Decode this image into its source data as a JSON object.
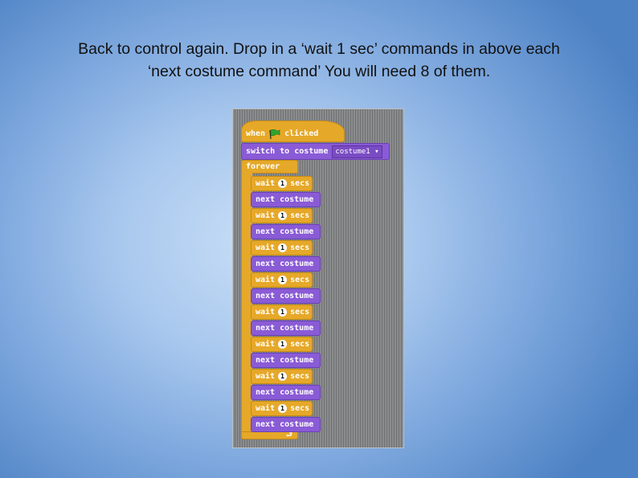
{
  "caption": {
    "line1": "Back to control again.  Drop in a ‘wait 1 sec’ commands in above each",
    "line2": "‘next costume command’  You will need 8 of them."
  },
  "script": {
    "hat": {
      "when": "when",
      "clicked": "clicked",
      "icon": "green-flag-icon"
    },
    "switch": {
      "label": "switch to costume",
      "value": "costume1"
    },
    "forever": "forever",
    "wait_label": "wait",
    "wait_value": "1",
    "secs_label": "secs",
    "next_label": "next costume",
    "pairs": 8
  },
  "colors": {
    "control": "#e6a828",
    "looks": "#8a5bd6",
    "flag": "#2fa52f"
  }
}
